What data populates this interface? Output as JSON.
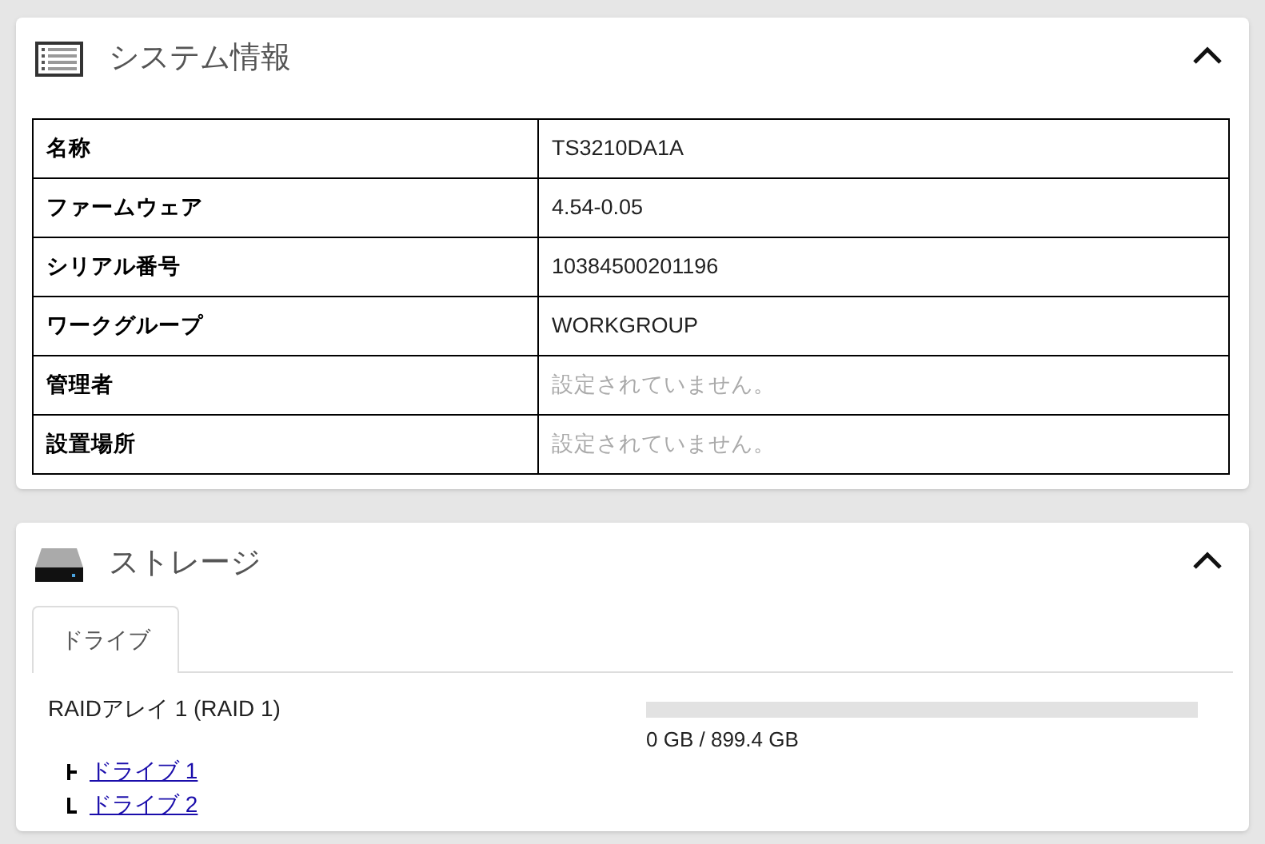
{
  "system_panel": {
    "title": "システム情報",
    "expanded": true,
    "rows": [
      {
        "label": "名称",
        "value": "TS3210DA1A",
        "unset": false
      },
      {
        "label": "ファームウェア",
        "value": "4.54-0.05",
        "unset": false
      },
      {
        "label": "シリアル番号",
        "value": "10384500201196",
        "unset": false
      },
      {
        "label": "ワークグループ",
        "value": "WORKGROUP",
        "unset": false
      },
      {
        "label": "管理者",
        "value": "設定されていません。",
        "unset": true
      },
      {
        "label": "設置場所",
        "value": "設定されていません。",
        "unset": true
      }
    ]
  },
  "storage_panel": {
    "title": "ストレージ",
    "expanded": true,
    "tabs": [
      {
        "label": "ドライブ",
        "selected": true
      }
    ],
    "arrays": [
      {
        "name": "RAIDアレイ 1 (RAID 1)",
        "usage": "0 GB / 899.4 GB",
        "children": [
          {
            "label": "ドライブ 1"
          },
          {
            "label": "ドライブ 2"
          }
        ]
      }
    ]
  }
}
